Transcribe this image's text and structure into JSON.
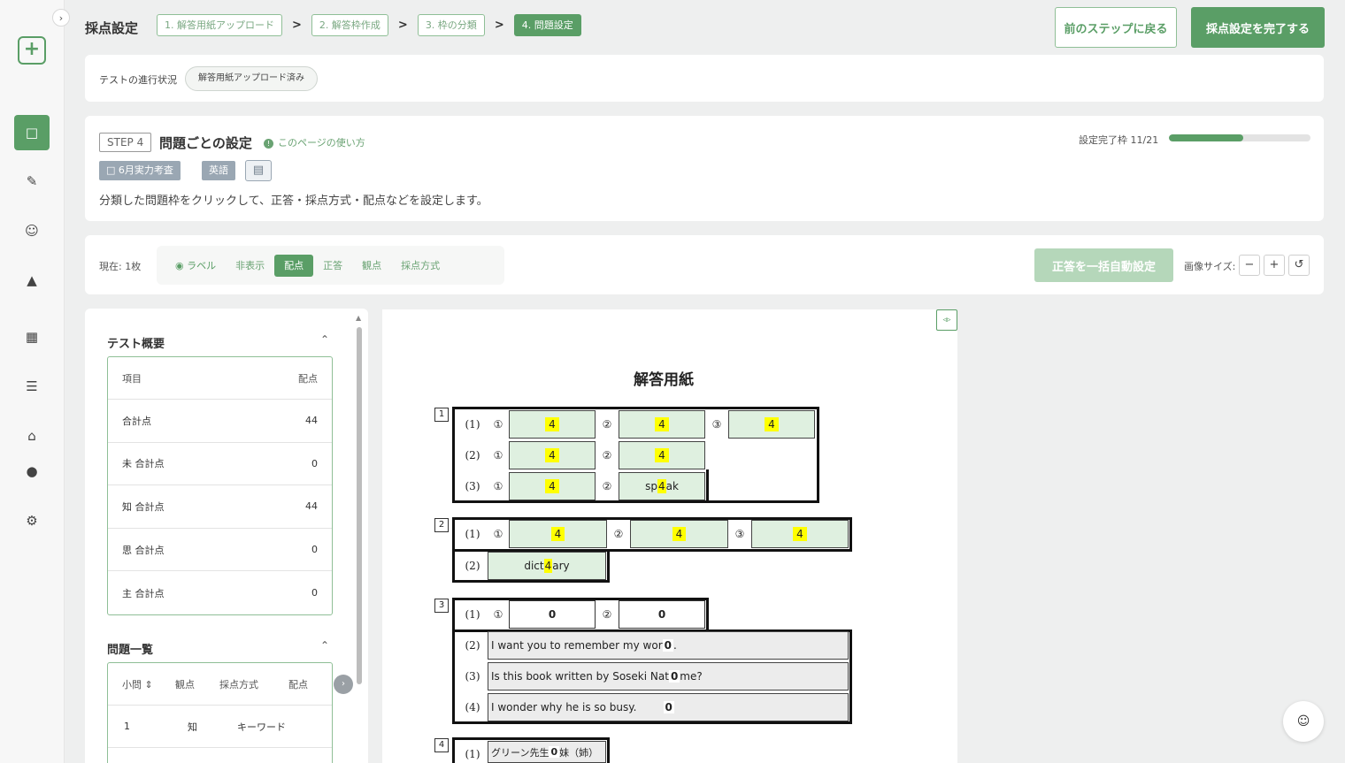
{
  "header": {
    "title": "採点設定",
    "steps": [
      "1. 解答用紙アップロード",
      "2. 解答枠作成",
      "3. 枠の分類",
      "4. 問題設定"
    ],
    "back_label": "前のステップに戻る",
    "finish_label": "採点設定を完了する"
  },
  "progress": {
    "label": "テストの進行状況",
    "status": "解答用紙アップロード済み"
  },
  "step": {
    "badge": "STEP 4",
    "title": "問題ごとの設定",
    "howto": "このページの使い方",
    "tags": [
      "6月実力考査",
      "英語"
    ],
    "description": "分類した問題枠をクリックして、正答・採点方式・配点などを設定します。",
    "done_label": "設定完了枠 11/21",
    "done_fraction": 0.524
  },
  "toolbar": {
    "current": "現在: 1枚",
    "modes": [
      "ラベル",
      "非表示",
      "配点",
      "正答",
      "観点",
      "採点方式"
    ],
    "active_mode": "配点",
    "auto_label": "正答を一括自動設定",
    "image_size_label": "画像サイズ:",
    "zoom_out": "−",
    "zoom_in": "+",
    "reset": "↺"
  },
  "summary": {
    "title": "テスト概要",
    "col_item": "項目",
    "col_score": "配点",
    "rows": [
      {
        "label": "合計点",
        "value": "44"
      },
      {
        "label": "未 合計点",
        "value": "0"
      },
      {
        "label": "知 合計点",
        "value": "44"
      },
      {
        "label": "思 合計点",
        "value": "0"
      },
      {
        "label": "主 合計点",
        "value": "0"
      }
    ]
  },
  "questions": {
    "title": "問題一覧",
    "cols": [
      "小問",
      "観点",
      "採点方式",
      "配点"
    ],
    "rows": [
      {
        "q": "1",
        "view": "知",
        "method": "キーワード"
      }
    ]
  },
  "sheet": {
    "title": "解答用紙",
    "labels": {
      "p1": "(1)",
      "p2": "(2)",
      "p3": "(3)",
      "p4": "(4)",
      "c1": "①",
      "c2": "②",
      "c3": "③",
      "n1": "1",
      "n2": "2",
      "n3": "3",
      "n4": "4"
    },
    "scores": {
      "q1": [
        "4",
        "4",
        "4",
        "4",
        "4",
        "4",
        "4"
      ],
      "q2": [
        "4",
        "4",
        "4",
        "4"
      ],
      "q3": [
        "0",
        "0",
        "0",
        "0",
        "0"
      ],
      "q4": [
        "0"
      ]
    },
    "texts": {
      "q1_3_2": "sp",
      "q1_3_2b": "ak",
      "q2_2a": "dict",
      "q2_2b": "ary",
      "q3_2a": "I want you to remember my wor",
      "q3_2b": ".",
      "q3_3a": "Is this book written by Soseki Nat",
      "q3_3b": "me?",
      "q3_4": "I wonder why he is so busy.",
      "q4_1a": "グリーン先生",
      "q4_1b": "妹（姉）"
    }
  }
}
